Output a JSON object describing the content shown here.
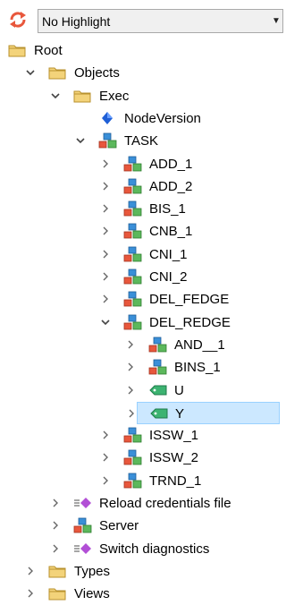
{
  "toolbar": {
    "icon": "refresh-icon",
    "highlight_select": {
      "value": "No Highlight"
    }
  },
  "tree": {
    "rows": [
      {
        "label": "Root",
        "icon": "folder",
        "level": 0,
        "chevron": "none"
      },
      {
        "label": "Objects",
        "icon": "folder",
        "level": 1,
        "chevron": "expanded"
      },
      {
        "label": "Exec",
        "icon": "folder",
        "level": 2,
        "chevron": "expanded"
      },
      {
        "label": "NodeVersion",
        "icon": "diamond",
        "level": 3,
        "chevron": "none"
      },
      {
        "label": "TASK",
        "icon": "cubes",
        "level": 3,
        "chevron": "expanded"
      },
      {
        "label": "ADD_1",
        "icon": "cubes",
        "level": 4,
        "chevron": "collapsed"
      },
      {
        "label": "ADD_2",
        "icon": "cubes",
        "level": 4,
        "chevron": "collapsed"
      },
      {
        "label": "BIS_1",
        "icon": "cubes",
        "level": 4,
        "chevron": "collapsed"
      },
      {
        "label": "CNB_1",
        "icon": "cubes",
        "level": 4,
        "chevron": "collapsed"
      },
      {
        "label": "CNI_1",
        "icon": "cubes",
        "level": 4,
        "chevron": "collapsed"
      },
      {
        "label": "CNI_2",
        "icon": "cubes",
        "level": 4,
        "chevron": "collapsed"
      },
      {
        "label": "DEL_FEDGE",
        "icon": "cubes",
        "level": 4,
        "chevron": "collapsed"
      },
      {
        "label": "DEL_REDGE",
        "icon": "cubes",
        "level": 4,
        "chevron": "expanded"
      },
      {
        "label": "AND__1",
        "icon": "cubes",
        "level": 5,
        "chevron": "collapsed"
      },
      {
        "label": "BINS_1",
        "icon": "cubes",
        "level": 5,
        "chevron": "collapsed"
      },
      {
        "label": "U",
        "icon": "tag",
        "level": 5,
        "chevron": "collapsed"
      },
      {
        "label": "Y",
        "icon": "tag",
        "level": 5,
        "chevron": "collapsed",
        "selected": true
      },
      {
        "label": "ISSW_1",
        "icon": "cubes",
        "level": 4,
        "chevron": "collapsed"
      },
      {
        "label": "ISSW_2",
        "icon": "cubes",
        "level": 4,
        "chevron": "collapsed"
      },
      {
        "label": "TRND_1",
        "icon": "cubes",
        "level": 4,
        "chevron": "collapsed"
      },
      {
        "label": "Reload credentials file",
        "icon": "method",
        "level": 2,
        "chevron": "collapsed"
      },
      {
        "label": "Server",
        "icon": "cubes",
        "level": 2,
        "chevron": "collapsed"
      },
      {
        "label": "Switch diagnostics",
        "icon": "method",
        "level": 2,
        "chevron": "collapsed"
      },
      {
        "label": "Types",
        "icon": "folder",
        "level": 1,
        "chevron": "collapsed"
      },
      {
        "label": "Views",
        "icon": "folder",
        "level": 1,
        "chevron": "collapsed"
      }
    ]
  },
  "colors": {
    "selection_bg": "#cce8ff",
    "selection_border": "#99d1ff",
    "folder_fill": "#f3d37a",
    "folder_stroke": "#b8922e",
    "cube_red": "#e8573c",
    "cube_blue": "#3a8fd8",
    "cube_green": "#5cb85c",
    "tag_green": "#3cb371",
    "diamond_blue": "#1f5fd6",
    "method_purple": "#b24fd6"
  }
}
